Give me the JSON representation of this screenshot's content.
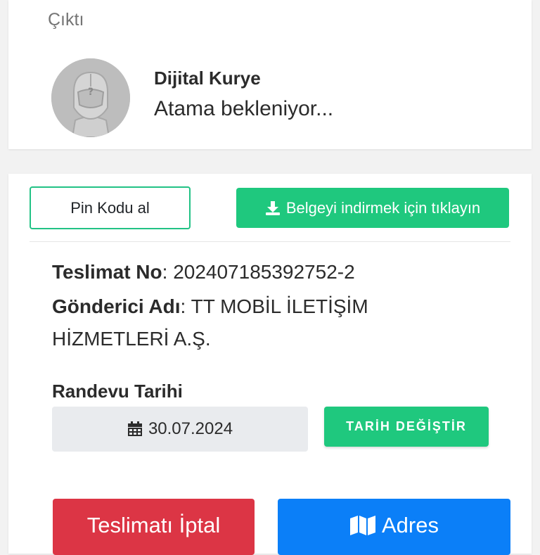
{
  "status_card": {
    "step_label": "Çıktı",
    "courier_title": "Dijital Kurye",
    "courier_status": "Atama bekleniyor..."
  },
  "actions": {
    "pin_label": "Pin Kodu al",
    "download_label": "Belgeyi indirmek için tıklayın",
    "download_icon": "download-icon"
  },
  "delivery": {
    "number_label": "Teslimat No",
    "number_value": "202407185392752-2",
    "sender_label": "Gönderici Adı",
    "sender_value": "TT MOBİL İLETİŞİM HİZMETLERİ A.Ş."
  },
  "appointment": {
    "label": "Randevu Tarihi",
    "date": "30.07.2024",
    "date_icon": "calendar-icon",
    "change_label": "TARİH DEĞİŞTİR"
  },
  "bottom_actions": {
    "cancel_label": "Teslimatı İptal",
    "address_label": "Adres",
    "address_icon": "map-icon"
  },
  "colors": {
    "green": "#1fc87e",
    "red": "#dc3545",
    "blue": "#0b7ff8"
  }
}
